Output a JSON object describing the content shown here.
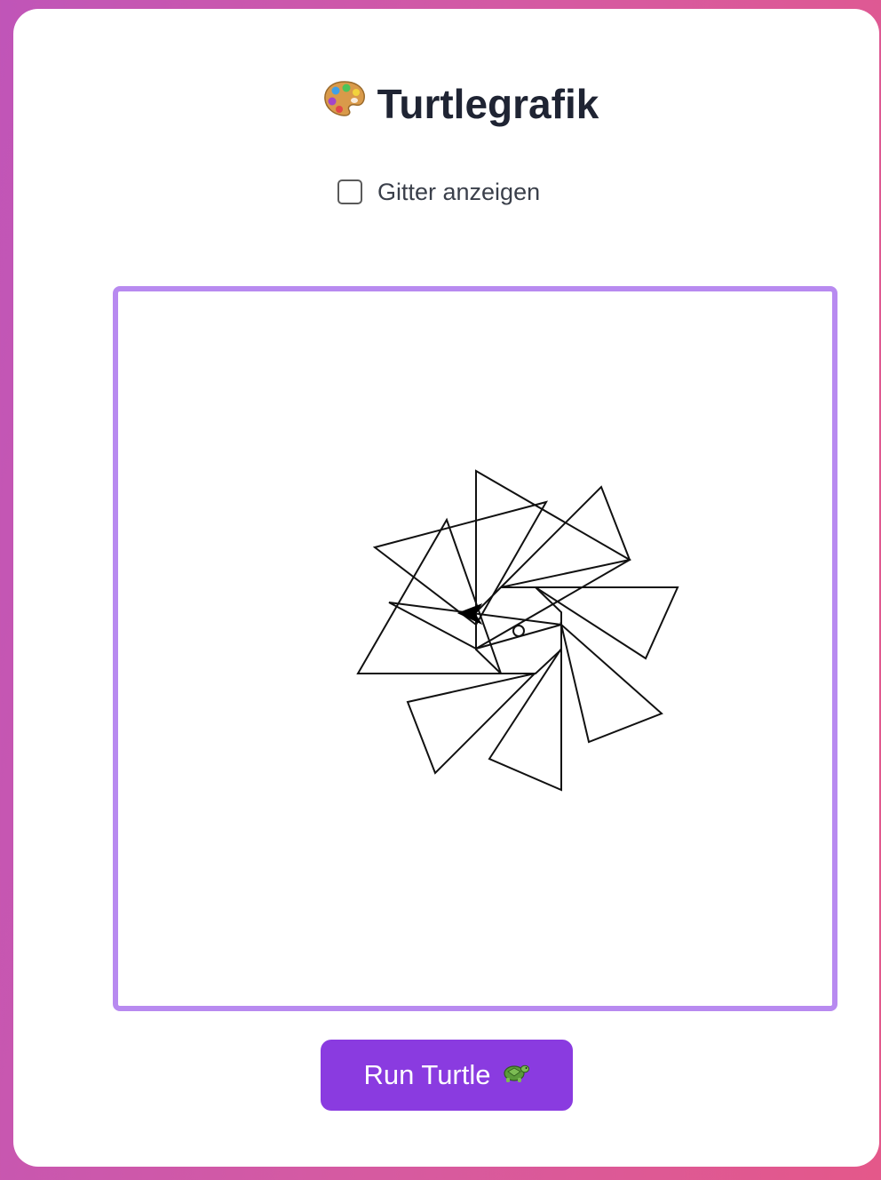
{
  "app": {
    "title": "Turtlegrafik",
    "title_icon": "artist-palette-icon"
  },
  "controls": {
    "grid_checkbox_label": "Gitter anzeigen",
    "grid_checked": false
  },
  "run_button": {
    "label": "Run Turtle",
    "icon": "turtle-icon"
  },
  "colors": {
    "canvas_border": "#b88af0",
    "button_background": "#8a3be0",
    "title_text": "#1f2433"
  },
  "drawing": {
    "triangle_count": 8,
    "turtle_cursor": "arrow"
  }
}
